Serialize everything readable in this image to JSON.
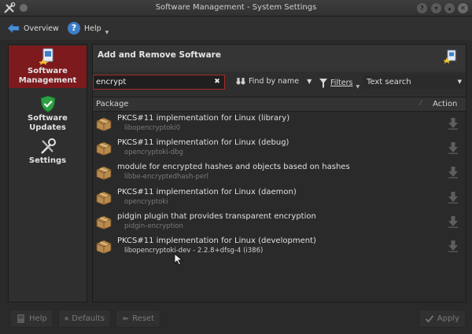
{
  "window": {
    "title": "Software Management - System Settings"
  },
  "toolbar": {
    "overview_label": "Overview",
    "help_label": "Help"
  },
  "sidebar": {
    "items": [
      {
        "label_line1": "Software",
        "label_line2": "Management",
        "active": true
      },
      {
        "label_line1": "Software",
        "label_line2": "Updates",
        "active": false
      },
      {
        "label_line1": "Settings",
        "label_line2": "",
        "active": false
      }
    ]
  },
  "panel": {
    "title": "Add and Remove Software",
    "search": {
      "value": "encrypt"
    },
    "find_by_label": "Find by name",
    "filters_label": "Filters",
    "search_mode": "Text search"
  },
  "table": {
    "headers": {
      "package": "Package",
      "action": "Action"
    },
    "rows": [
      {
        "summary": "PKCS#11 implementation for Linux (library)",
        "name": "libopencryptoki0"
      },
      {
        "summary": "PKCS#11 implementation for Linux (debug)",
        "name": "opencryptoki-dbg"
      },
      {
        "summary": "module for encrypted hashes and objects based on hashes",
        "name": "libbe-encryptedhash-perl"
      },
      {
        "summary": "PKCS#11 implementation for Linux (daemon)",
        "name": "opencryptoki"
      },
      {
        "summary": "pidgin plugin that provides transparent encryption",
        "name": "pidgin-encryption"
      },
      {
        "summary": "PKCS#11 implementation for Linux (development)",
        "name": "libopencryptoki-dev - 2.2.8+dfsg-4 (i386)"
      }
    ]
  },
  "buttons": {
    "help": "Help",
    "defaults": "Defaults",
    "reset": "Reset",
    "apply": "Apply"
  },
  "colors": {
    "accent": "#7c1a1d",
    "background": "#2a2a2a",
    "search_border": "#a52a2a"
  }
}
